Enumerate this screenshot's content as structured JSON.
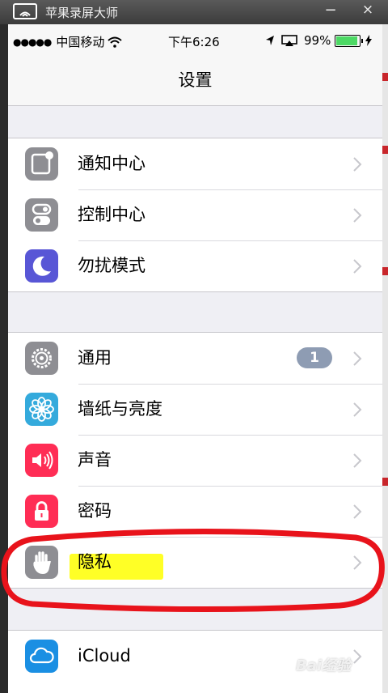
{
  "window": {
    "title": "苹果录屏大师",
    "minimize": "−",
    "close": "×"
  },
  "status_bar": {
    "signal": "●●●●●",
    "carrier": "中国移动",
    "time": "下午6:26",
    "battery_pct": "99%",
    "battery_level": 0.99
  },
  "nav": {
    "title": "设置"
  },
  "groups": [
    {
      "items": [
        {
          "label": "通知中心",
          "icon": "notification-center-icon",
          "color": "#8e8e93"
        },
        {
          "label": "控制中心",
          "icon": "control-center-icon",
          "color": "#8e8e93"
        },
        {
          "label": "勿扰模式",
          "icon": "moon-icon",
          "color": "#5856d6"
        }
      ]
    },
    {
      "items": [
        {
          "label": "通用",
          "icon": "gear-icon",
          "color": "#8e8e93",
          "badge": "1"
        },
        {
          "label": "墙纸与亮度",
          "icon": "wallpaper-flower-icon",
          "color": "#34aadc"
        },
        {
          "label": "声音",
          "icon": "speaker-icon",
          "color": "#ff2d55"
        },
        {
          "label": "密码",
          "icon": "lock-icon",
          "color": "#ff2d55"
        },
        {
          "label": "隐私",
          "icon": "hand-icon",
          "color": "#8e8e93"
        }
      ]
    },
    {
      "items": [
        {
          "label": "iCloud",
          "icon": "icloud-icon",
          "color": "#1a8fe3"
        }
      ]
    }
  ],
  "colors": {
    "annotation": "#e8131b",
    "highlight": "#ffff00"
  },
  "watermark": "Bai经验"
}
